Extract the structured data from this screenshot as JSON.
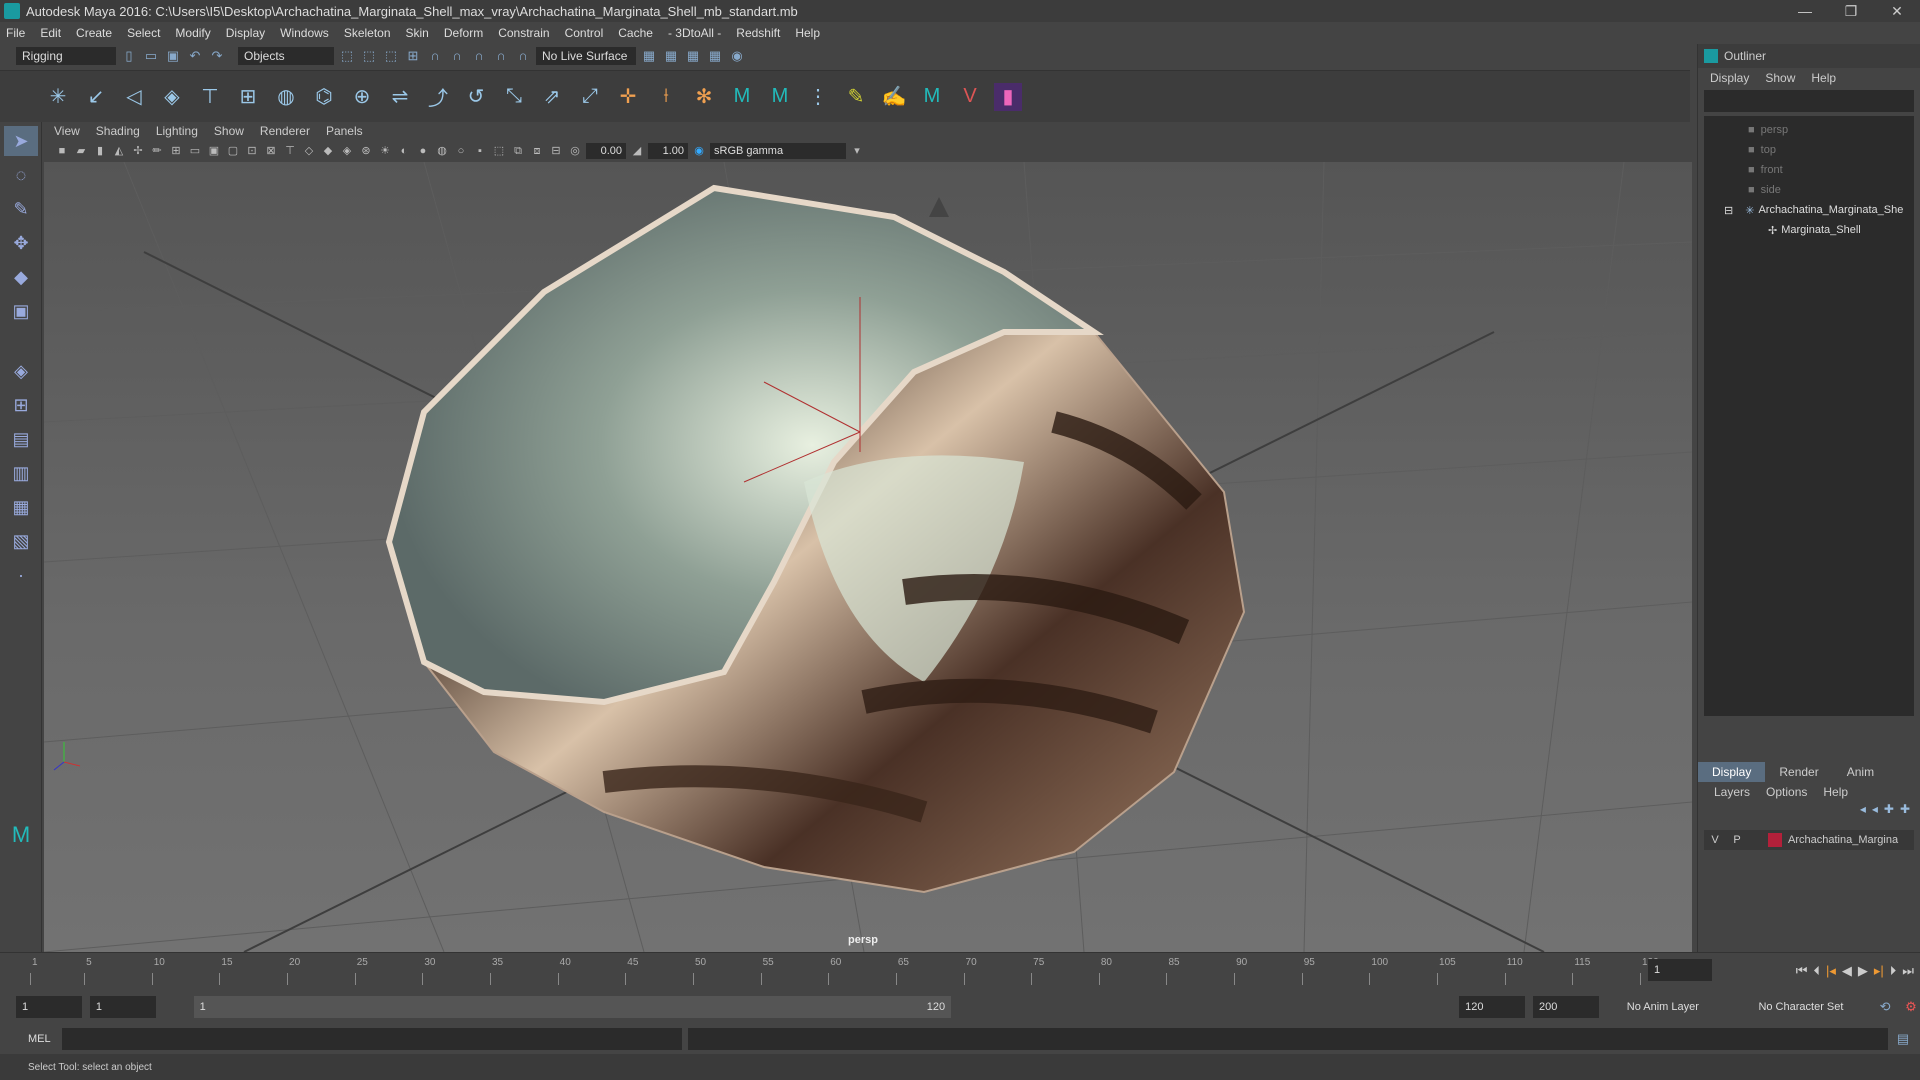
{
  "title": "Autodesk Maya 2016: C:\\Users\\I5\\Desktop\\Archachatina_Marginata_Shell_max_vray\\Archachatina_Marginata_Shell_mb_standart.mb",
  "window_buttons": [
    "—",
    "❐",
    "✕"
  ],
  "menu": [
    "File",
    "Edit",
    "Create",
    "Select",
    "Modify",
    "Display",
    "Windows",
    "Skeleton",
    "Skin",
    "Deform",
    "Constrain",
    "Control",
    "Cache",
    "- 3DtoAll -",
    "Redshift",
    "Help"
  ],
  "status": {
    "mode": "Rigging",
    "selection_mask": "Objects",
    "live_surface": "No Live Surface"
  },
  "viewport_menu": [
    "View",
    "Shading",
    "Lighting",
    "Show",
    "Renderer",
    "Panels"
  ],
  "viewport_toolbar": {
    "exposure": "0.00",
    "gamma": "1.00",
    "colorspace": "sRGB gamma"
  },
  "viewport_label": "persp",
  "outliner": {
    "title": "Outliner",
    "menu": [
      "Display",
      "Show",
      "Help"
    ],
    "items": [
      "persp",
      "top",
      "front",
      "side",
      "Archachatina_Marginata_She",
      "Marginata_Shell"
    ]
  },
  "layers": {
    "tabs": [
      "Display",
      "Render",
      "Anim"
    ],
    "menu": [
      "Layers",
      "Options",
      "Help"
    ],
    "row": {
      "v": "V",
      "p": "P",
      "name": "Archachatina_Margina",
      "color": "#b3203a"
    }
  },
  "timeline": {
    "ticks": [
      "1",
      "5",
      "10",
      "15",
      "20",
      "25",
      "30",
      "35",
      "40",
      "45",
      "50",
      "55",
      "60",
      "65",
      "70",
      "75",
      "80",
      "85",
      "90",
      "95",
      "100",
      "105",
      "110",
      "115",
      "120"
    ],
    "current_frame": "1"
  },
  "range": {
    "start": "1",
    "playback_start": "1",
    "slider_start": "1",
    "slider_end": "120",
    "playback_end": "120",
    "end": "200",
    "anim_layer": "No Anim Layer",
    "character_set": "No Character Set"
  },
  "cmd": {
    "label": "MEL"
  },
  "help_line": "Select Tool: select an object"
}
